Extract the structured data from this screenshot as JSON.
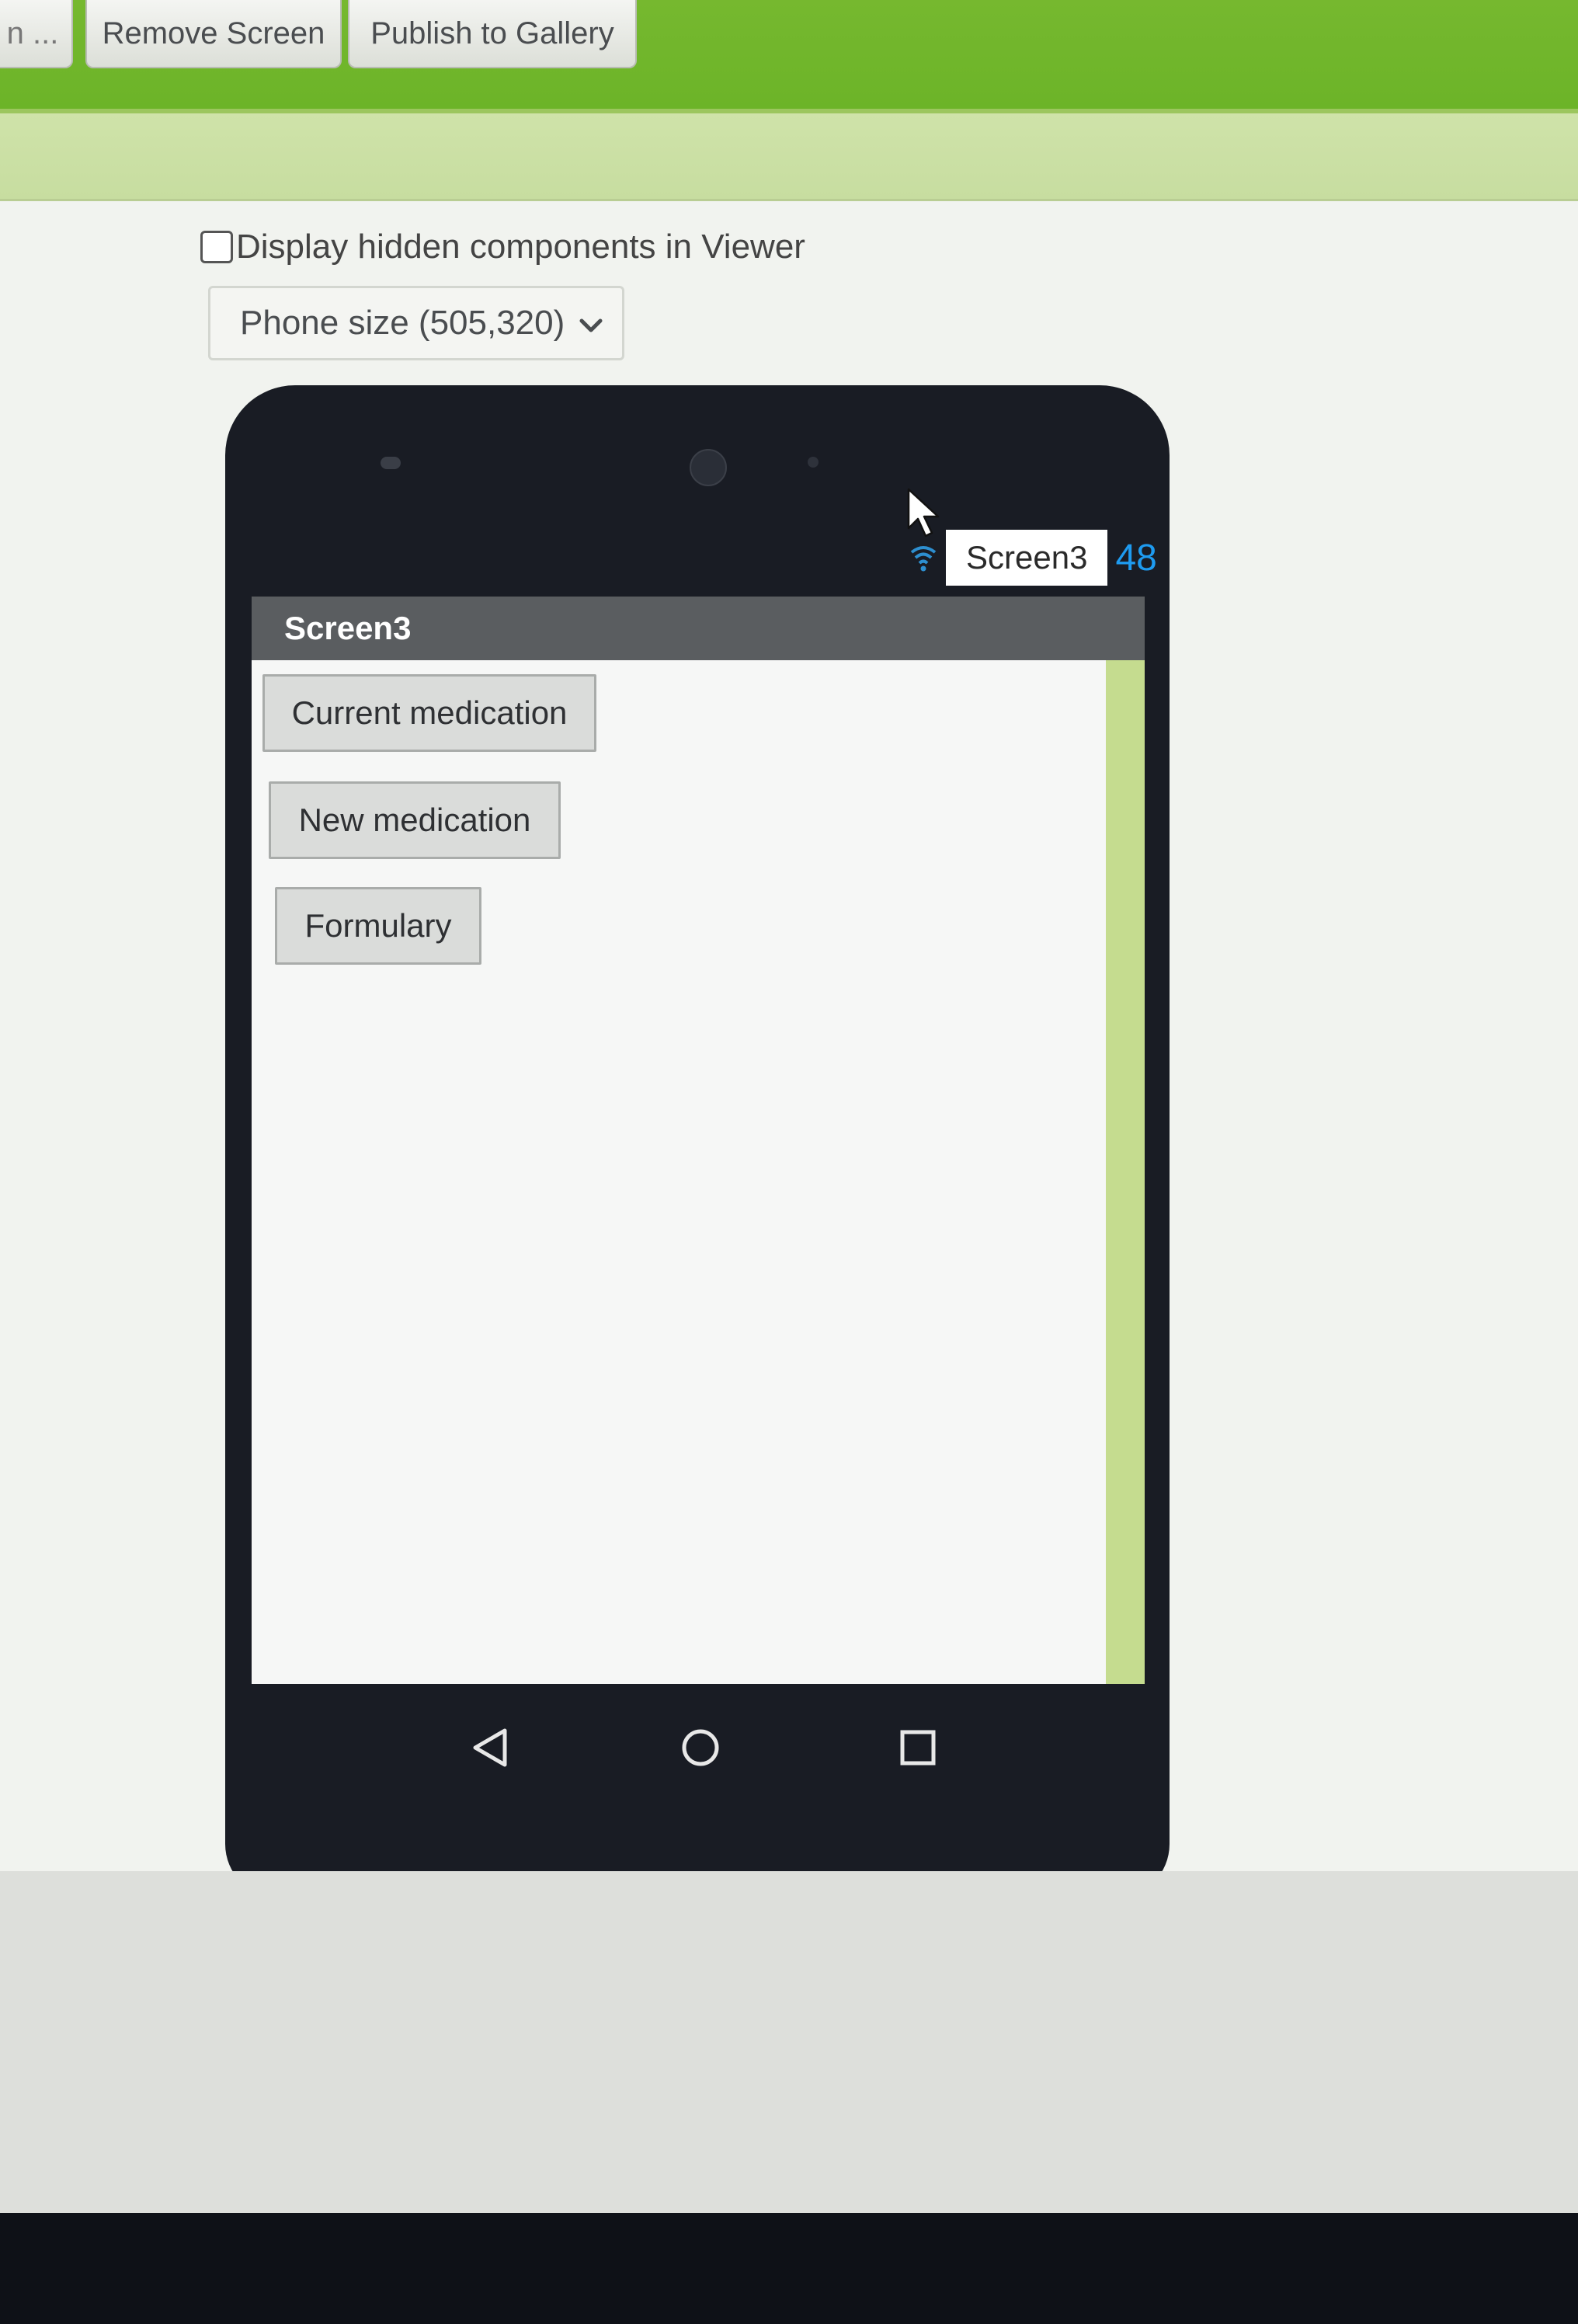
{
  "toolbar": {
    "partial_label": "n ...",
    "remove_screen_label": "Remove Screen",
    "publish_label": "Publish to Gallery"
  },
  "viewer": {
    "hidden_components_label": "Display hidden components in Viewer",
    "hidden_components_checked": false,
    "phone_size_value": "Phone size (505,320)"
  },
  "phone": {
    "status_title": "Screen3",
    "status_number": "48",
    "screen_title": "Screen3",
    "buttons": [
      {
        "label": "Current medication"
      },
      {
        "label": "New medication"
      },
      {
        "label": "Formulary"
      }
    ],
    "nav_icons": [
      "back-icon",
      "home-icon",
      "recent-apps-icon"
    ]
  },
  "colors": {
    "toolbar_green": "#6cb428",
    "status_number_blue": "#1e9bf0",
    "title_bar_gray": "#5a5d60"
  }
}
